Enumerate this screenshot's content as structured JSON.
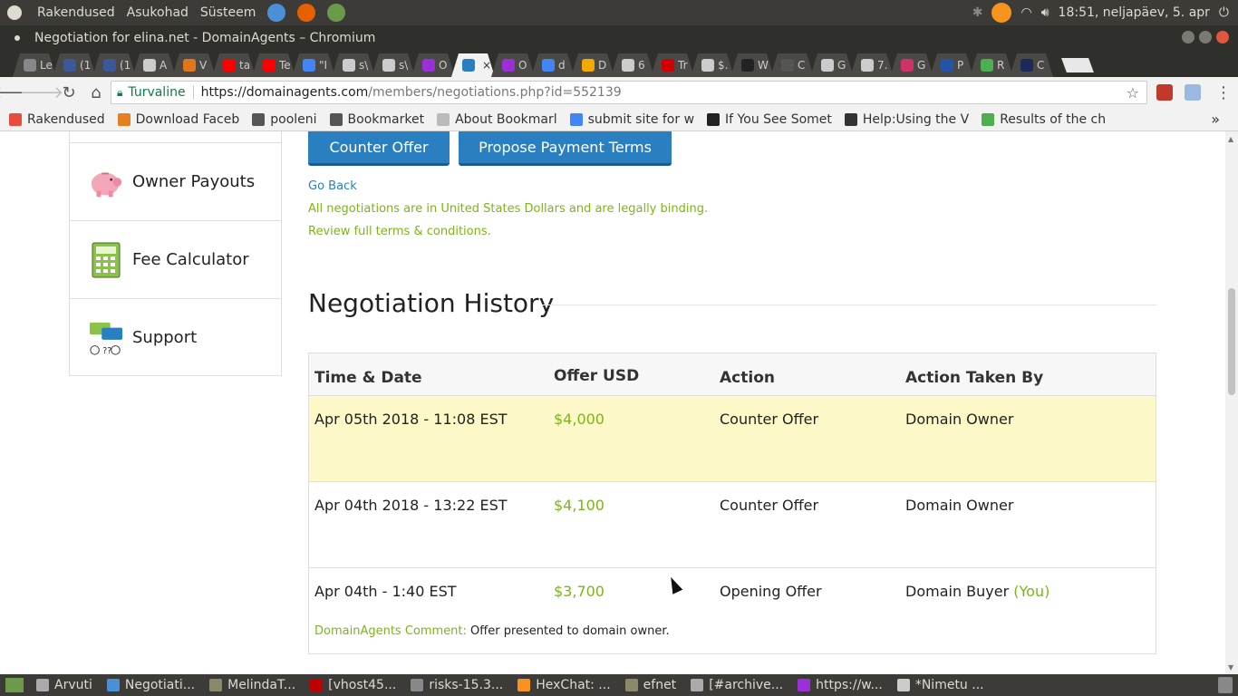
{
  "top_panel": {
    "menu": [
      "Rakendused",
      "Asukohad",
      "Süsteem"
    ],
    "clock": "18:51, neljapäev, 5. apr"
  },
  "window": {
    "title": "Negotiation for elina.net - DomainAgents – Chromium"
  },
  "tabs": [
    {
      "label": "Le",
      "icon": "puzzle-icon",
      "color": "#888888"
    },
    {
      "label": "(1",
      "icon": "facebook-icon",
      "color": "#3b5998"
    },
    {
      "label": "(1",
      "icon": "facebook-icon",
      "color": "#3b5998"
    },
    {
      "label": "A",
      "icon": "page-icon",
      "color": "#cccccc"
    },
    {
      "label": "V",
      "icon": "metamask-icon",
      "color": "#e2761b"
    },
    {
      "label": "ta",
      "icon": "youtube-icon",
      "color": "#ff0000"
    },
    {
      "label": "Te",
      "icon": "youtube-icon",
      "color": "#ff0000"
    },
    {
      "label": "\"I",
      "icon": "google-icon",
      "color": "#4285f4"
    },
    {
      "label": "s\\",
      "icon": "page-icon",
      "color": "#cccccc"
    },
    {
      "label": "s\\",
      "icon": "page-icon",
      "color": "#cccccc"
    },
    {
      "label": "O",
      "icon": "cloud-icon",
      "color": "#9b30d9"
    },
    {
      "label": "",
      "icon": "domainagents-icon",
      "color": "#2a7fc0",
      "active": true
    },
    {
      "label": "O",
      "icon": "cloud-icon",
      "color": "#9b30d9"
    },
    {
      "label": "d",
      "icon": "google-icon",
      "color": "#4285f4"
    },
    {
      "label": "D",
      "icon": "stripes-icon",
      "color": "#f2a900"
    },
    {
      "label": "6",
      "icon": "page-icon",
      "color": "#cccccc"
    },
    {
      "label": "Tr",
      "icon": "r-icon",
      "color": "#d00000"
    },
    {
      "label": "$.",
      "icon": "page-icon",
      "color": "#cccccc"
    },
    {
      "label": "W",
      "icon": "building-icon",
      "color": "#222222"
    },
    {
      "label": "C",
      "icon": "book-icon",
      "color": "#555555"
    },
    {
      "label": "G",
      "icon": "page-icon",
      "color": "#cccccc"
    },
    {
      "label": "7.",
      "icon": "page-icon",
      "color": "#cccccc"
    },
    {
      "label": "G",
      "icon": "skull-icon",
      "color": "#cc3366"
    },
    {
      "label": "P",
      "icon": "epi-icon",
      "color": "#2255aa"
    },
    {
      "label": "R",
      "icon": "leaf-icon",
      "color": "#4caf50"
    },
    {
      "label": "C",
      "icon": "crest-icon",
      "color": "#1a2a5a"
    }
  ],
  "toolbar": {
    "secure_label": "Turvaline",
    "url_host": "https://domainagents.com",
    "url_path": "/members/negotiations.php?id=552139"
  },
  "bookmarks": [
    {
      "label": "Rakendused",
      "icon": "apps-grid-icon",
      "color": "#e74c3c"
    },
    {
      "label": "Download Faceb",
      "icon": "bookmark-favicon",
      "color": "#e67e22"
    },
    {
      "label": "pooleni",
      "icon": "folder-icon",
      "color": "#555555"
    },
    {
      "label": "Bookmarket",
      "icon": "folder-icon",
      "color": "#555555"
    },
    {
      "label": "About Bookmarl",
      "icon": "page-icon",
      "color": "#bbbbbb"
    },
    {
      "label": "submit site for w",
      "icon": "google-icon",
      "color": "#4285f4"
    },
    {
      "label": "If You See Somet",
      "icon": "building-icon",
      "color": "#222222"
    },
    {
      "label": "Help:Using the V",
      "icon": "wikipedia-icon",
      "color": "#333333"
    },
    {
      "label": "Results of the ch",
      "icon": "leaf-icon",
      "color": "#4caf50"
    }
  ],
  "sidebar": {
    "items": [
      {
        "label": "Owner Payouts",
        "icon": "piggy-bank-icon"
      },
      {
        "label": "Fee Calculator",
        "icon": "calculator-icon"
      },
      {
        "label": "Support",
        "icon": "support-chat-icon"
      }
    ]
  },
  "actions": {
    "counter_offer": "Counter Offer",
    "propose_terms": "Propose Payment Terms",
    "go_back": "Go Back",
    "notice": "All negotiations are in United States Dollars and are legally binding.",
    "terms_link": "Review full terms & conditions."
  },
  "history": {
    "title": "Negotiation History",
    "columns": [
      "Time & Date",
      "Offer USD",
      "Action",
      "Action Taken By"
    ],
    "rows": [
      {
        "date": "Apr 05th 2018 - 11:08 EST",
        "offer": "$4,000",
        "action": "Counter Offer",
        "by": "Domain Owner",
        "highlight": true
      },
      {
        "date": "Apr 04th 2018 - 13:22 EST",
        "offer": "$4,100",
        "action": "Counter Offer",
        "by": "Domain Owner"
      },
      {
        "date": "Apr 04th - 1:40 EST",
        "offer": "$3,700",
        "action": "Opening Offer",
        "by": "Domain Buyer",
        "by_suffix": "(You)",
        "comment_label": "DomainAgents Comment:",
        "comment": "Offer presented to domain owner."
      }
    ]
  },
  "taskbar": [
    {
      "label": "Arvuti",
      "icon": "computer-icon",
      "color": "#aaaaaa"
    },
    {
      "label": "Negotiati...",
      "icon": "chromium-icon",
      "color": "#4a90d9"
    },
    {
      "label": "MelindaT...",
      "icon": "folder-icon",
      "color": "#8a8a6a"
    },
    {
      "label": "[vhost45...",
      "icon": "filezilla-icon",
      "color": "#bf0000"
    },
    {
      "label": "risks-15.3...",
      "icon": "disk-icon",
      "color": "#888888"
    },
    {
      "label": "HexChat: ...",
      "icon": "hexchat-icon",
      "color": "#f7941d"
    },
    {
      "label": "efnet",
      "icon": "folder-icon",
      "color": "#8a8a6a"
    },
    {
      "label": "[#archive...",
      "icon": "editor-icon",
      "color": "#aaaaaa"
    },
    {
      "label": "https://w...",
      "icon": "cloud-icon",
      "color": "#9b30d9"
    },
    {
      "label": "*Nimetu ...",
      "icon": "text-editor-icon",
      "color": "#cccccc"
    }
  ],
  "colors": {
    "brand_blue": "#2a7fc0",
    "accent_green": "#7cb518",
    "highlight_row": "#fcf8c7"
  }
}
